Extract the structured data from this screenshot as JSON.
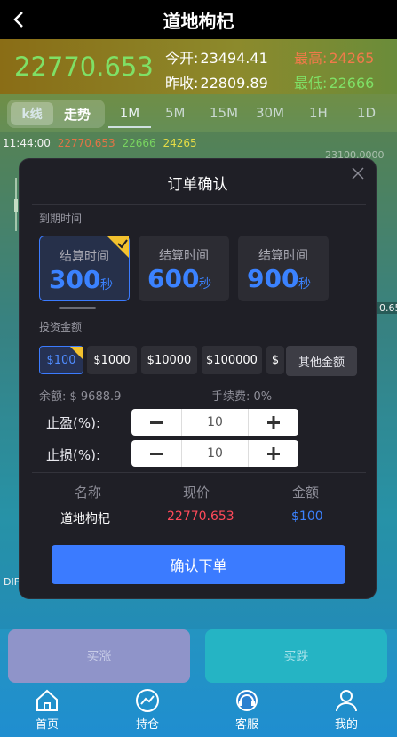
{
  "header": {
    "title": "道地枸杞"
  },
  "quote": {
    "price": "22770.653",
    "open_label": "今开:",
    "open": "23494.41",
    "high_label": "最高:",
    "high": "24265",
    "prev_label": "昨收:",
    "prev": "22809.89",
    "low_label": "最低:",
    "low": "22666"
  },
  "tabs": {
    "kline": "k线",
    "trend": "走势",
    "periods": [
      "1M",
      "5M",
      "15M",
      "30M",
      "1H",
      "1D"
    ]
  },
  "ticker": {
    "time": "11:44:00",
    "v1": "22770.653",
    "v2": "22666",
    "v3": "24265"
  },
  "chart_labels": {
    "y1": "23100.0000",
    "right": "0.65",
    "left": "DIF"
  },
  "modal": {
    "title": "订单确认",
    "expiry_label": "到期时间",
    "time_options": [
      {
        "label": "结算时间",
        "value": "300",
        "unit": "秒"
      },
      {
        "label": "结算时间",
        "value": "600",
        "unit": "秒"
      },
      {
        "label": "结算时间",
        "value": "900",
        "unit": "秒"
      }
    ],
    "amount_label": "投资金额",
    "amounts": [
      "$100",
      "$1000",
      "$10000",
      "$100000",
      "$"
    ],
    "other_amount": "其他金额",
    "balance": "余额: $ 9688.9",
    "fee": "手续费: 0%",
    "take_profit_label": "止盈(%):",
    "take_profit": "10",
    "stop_loss_label": "止损(%):",
    "stop_loss": "10",
    "columns": {
      "name": "名称",
      "price": "现价",
      "amount": "金额"
    },
    "row": {
      "name": "道地枸杞",
      "price": "22770.653",
      "amount": "$100"
    },
    "confirm": "确认下单"
  },
  "actions": {
    "buy_up": "买涨",
    "buy_down": "买跌"
  },
  "nav": [
    "首页",
    "持仓",
    "客服",
    "我的"
  ],
  "colors": {
    "up": "#7fe066",
    "accent": "#3b7bff",
    "high": "#f07a4a",
    "low": "#7fe066"
  }
}
